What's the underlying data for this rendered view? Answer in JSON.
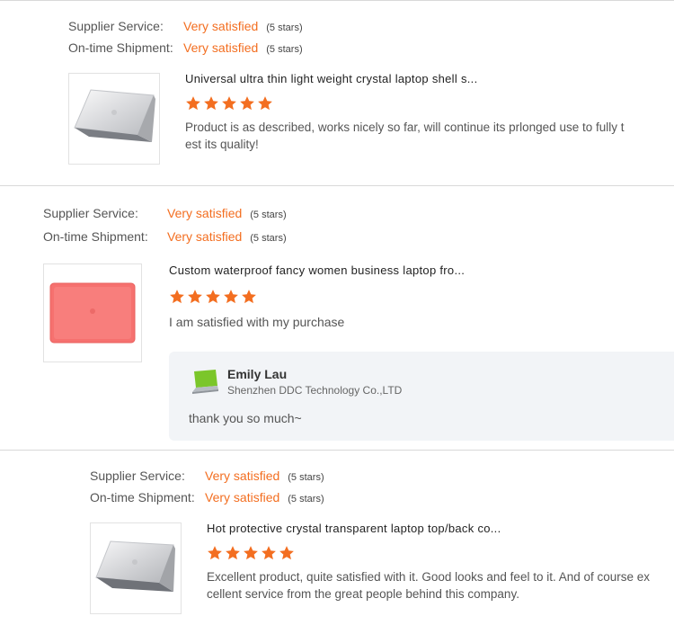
{
  "reviews": [
    {
      "supplier_label": "Supplier Service:",
      "supplier_value": "Very satisfied",
      "supplier_stars": "(5 stars)",
      "shipment_label": "On-time Shipment:",
      "shipment_value": "Very satisfied",
      "shipment_stars": "(5 stars)",
      "product_title": "Universal ultra thin light weight crystal laptop shell s...",
      "rating": 5,
      "comment_line1": "Product is as described, works nicely so far, will continue its prlonged use to fully t",
      "comment_line2": "est its quality!",
      "thumb_type": "clear-laptop-shell"
    },
    {
      "supplier_label": "Supplier Service:",
      "supplier_value": "Very satisfied",
      "supplier_stars": "(5 stars)",
      "shipment_label": "On-time Shipment:",
      "shipment_value": "Very satisfied",
      "shipment_stars": "(5 stars)",
      "product_title": "Custom waterproof fancy women business laptop fro...",
      "rating": 5,
      "comment_line1": "I am satisfied with my purchase",
      "thumb_type": "coral-laptop-shell",
      "reply": {
        "name": "Emily Lau",
        "company": "Shenzhen DDC Technology Co.,LTD",
        "text": "thank you so much~",
        "logo": "green-laptop-logo-icon"
      }
    },
    {
      "supplier_label": "Supplier Service:",
      "supplier_value": "Very satisfied",
      "supplier_stars": "(5 stars)",
      "shipment_label": "On-time Shipment:",
      "shipment_value": "Very satisfied",
      "shipment_stars": "(5 stars)",
      "product_title": "Hot protective crystal transparent laptop top/back co...",
      "rating": 5,
      "comment_line1": "Excellent product, quite satisfied with it. Good looks and feel to it. And of course ex",
      "comment_line2": "cellent service from the great people behind this company.",
      "thumb_type": "clear-laptop-shell"
    }
  ],
  "colors": {
    "accent": "#f36e20",
    "star": "#f36e20",
    "reply_bg": "#f2f4f7",
    "divider": "#d9d9d9"
  }
}
